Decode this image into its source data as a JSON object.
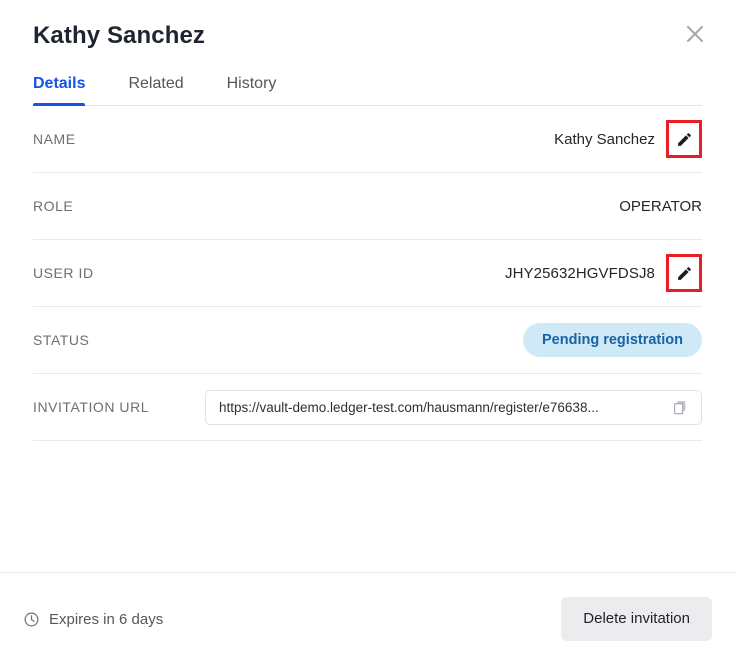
{
  "header": {
    "title": "Kathy Sanchez",
    "close_icon": "close-icon"
  },
  "tabs": [
    {
      "label": "Details",
      "active": true
    },
    {
      "label": "Related",
      "active": false
    },
    {
      "label": "History",
      "active": false
    }
  ],
  "details": {
    "rows": [
      {
        "label": "NAME",
        "value": "Kathy Sanchez",
        "type": "text",
        "editable": true,
        "edit_icon": "pencil-icon"
      },
      {
        "label": "ROLE",
        "value": "OPERATOR",
        "type": "text",
        "editable": false
      },
      {
        "label": "USER ID",
        "value": "JHY25632HGVFDSJ8",
        "type": "text",
        "editable": true,
        "edit_icon": "pencil-icon"
      },
      {
        "label": "STATUS",
        "value": "Pending registration",
        "type": "badge",
        "editable": false
      },
      {
        "label": "INVITATION URL",
        "value": "https://vault-demo.ledger-test.com/hausmann/register/e76638...",
        "type": "url",
        "editable": false,
        "copy_icon": "copy-icon"
      }
    ]
  },
  "footer": {
    "expiry_icon": "clock-icon",
    "expiry_text": "Expires in 6 days",
    "delete_label": "Delete invitation"
  },
  "colors": {
    "accent_blue": "#1752e8",
    "badge_bg": "#cfe9f7",
    "badge_text": "#1763a5",
    "annotation_red": "#ec1c24",
    "label_gray": "#6b6f76",
    "button_gray": "#ececee"
  }
}
